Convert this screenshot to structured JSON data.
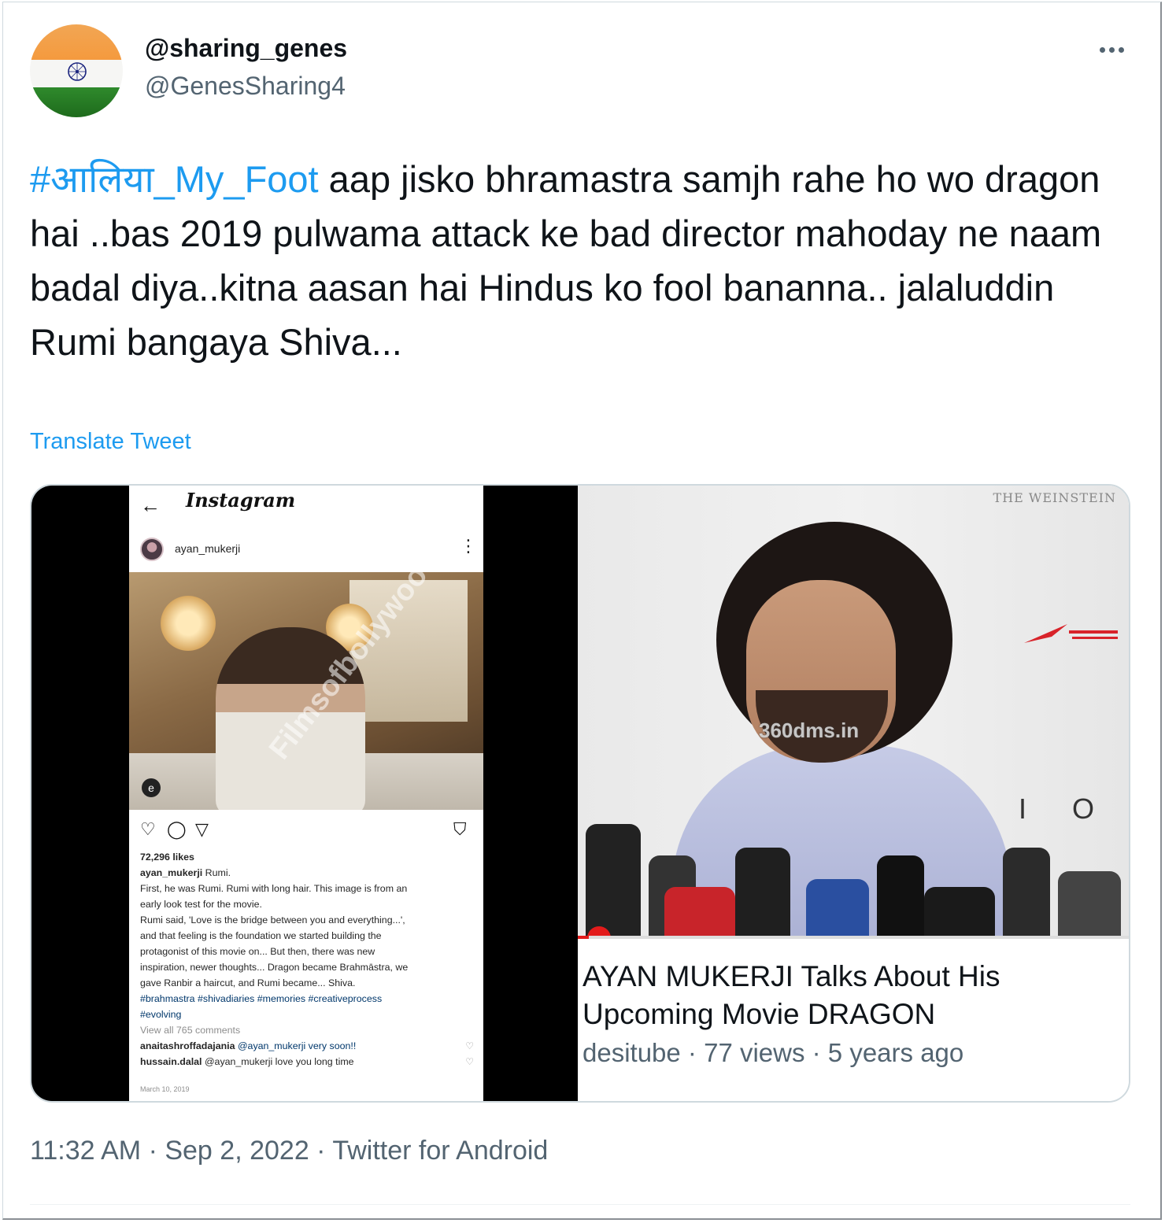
{
  "author": {
    "name": "@sharing_genes",
    "handle": "@GenesSharing4"
  },
  "tweet": {
    "hashtag": "#आलिया_My_Foot",
    "text": " aap jisko bhramastra samjh rahe ho wo dragon hai ..bas 2019 pulwama attack ke bad director mahoday ne naam badal diya..kitna aasan hai Hindus ko fool bananna.. jalaluddin Rumi bangaya Shiva...",
    "translate_label": "Translate Tweet"
  },
  "media": {
    "instagram": {
      "brand": "Instagram",
      "username": "ayan_mukerji",
      "likes": "72,296 likes",
      "caption_user": "ayan_mukerji",
      "caption_lines": [
        "Rumi.",
        "First, he was Rumi. Rumi with long hair. This image is from an",
        "early look test for the movie.",
        "Rumi said, 'Love is the bridge between you and everything...',",
        "and that feeling is the foundation we started building the",
        "protagonist of this movie on... But then, there was new",
        "inspiration, newer thoughts... Dragon became Brahmāstra, we",
        "gave Ranbir a haircut, and Rumi became... Shiva."
      ],
      "tags_line1": "#brahmastra #shivadiaries #memories  #creativeprocess",
      "tags_line2": "#evolving",
      "view_comments": "View all 765 comments",
      "comments": [
        {
          "user": "anaitashroffadajania",
          "text": "@ayan_mukerji very soon!!"
        },
        {
          "user": "hussain.dalal",
          "text": "@ayan_mukerji love you long time"
        }
      ],
      "date": "March 10, 2019",
      "watermark": "Filmsofbollywood"
    },
    "video": {
      "overlay_top_right": "THE WEINSTEIN",
      "overlay_watermark": "360dms.in",
      "overlay_io": "I O",
      "title": "AYAN MUKERJI Talks About His Upcoming Movie DRAGON",
      "meta": "desitube · 77 views · 5 years ago",
      "progress_fraction": 0.02
    }
  },
  "footer": {
    "timestamp": "11:32 AM · Sep 2, 2022 · Twitter for Android"
  },
  "colors": {
    "link": "#1d9bf0",
    "muted": "#536471",
    "text": "#0f1419"
  },
  "icons": [
    "more-icon",
    "back-arrow-icon",
    "heart-icon",
    "comment-icon",
    "share-icon",
    "bookmark-icon"
  ]
}
